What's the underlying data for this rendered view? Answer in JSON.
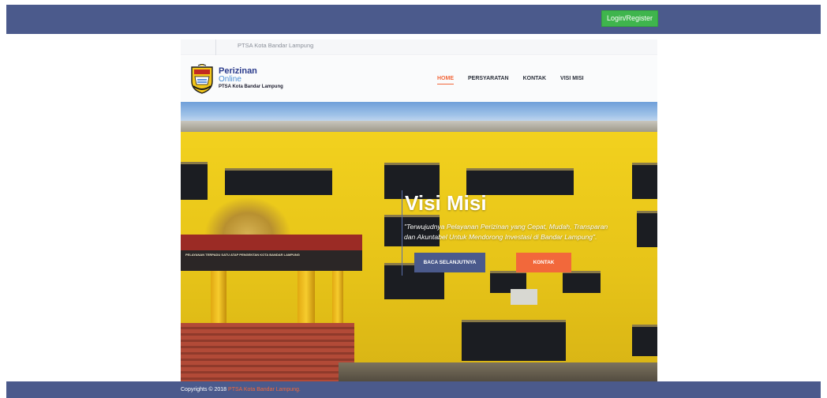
{
  "header": {
    "login_label": "Login/Register"
  },
  "info_bar": {
    "text": "PTSA Kota Bandar Lampung"
  },
  "brand": {
    "line1": "Perizinan",
    "line2": "Online",
    "line3": "PTSA Kota Bandar Lampung"
  },
  "nav": {
    "items": [
      {
        "label": "HOME",
        "active": true
      },
      {
        "label": "PERSYARATAN",
        "active": false
      },
      {
        "label": "KONTAK",
        "active": false
      },
      {
        "label": "VISI MISI",
        "active": false
      }
    ]
  },
  "hero": {
    "title": "Visi Misi",
    "description_line1": "\"Terwujudnya Pelayanan Perizinan yang Cepat, Mudah, Transparan",
    "description_line2": "dan Akuntabel Untuk Mendorong Investasi di Bandar Lampung\".",
    "primary_button": "BACA SELANJUTNYA",
    "secondary_button": "KONTAK",
    "building_sign": "PELAYANAN TERPADU SATU ATAP PENGENTAN KOTA BANDAR LAMPUNG"
  },
  "footer": {
    "prefix": "Copyrights © 2018",
    "link": "PTSA Kota Bandar Lampung."
  },
  "colors": {
    "primary": "#4b5a8c",
    "accent": "#f2683b",
    "login": "#3fb54d"
  }
}
